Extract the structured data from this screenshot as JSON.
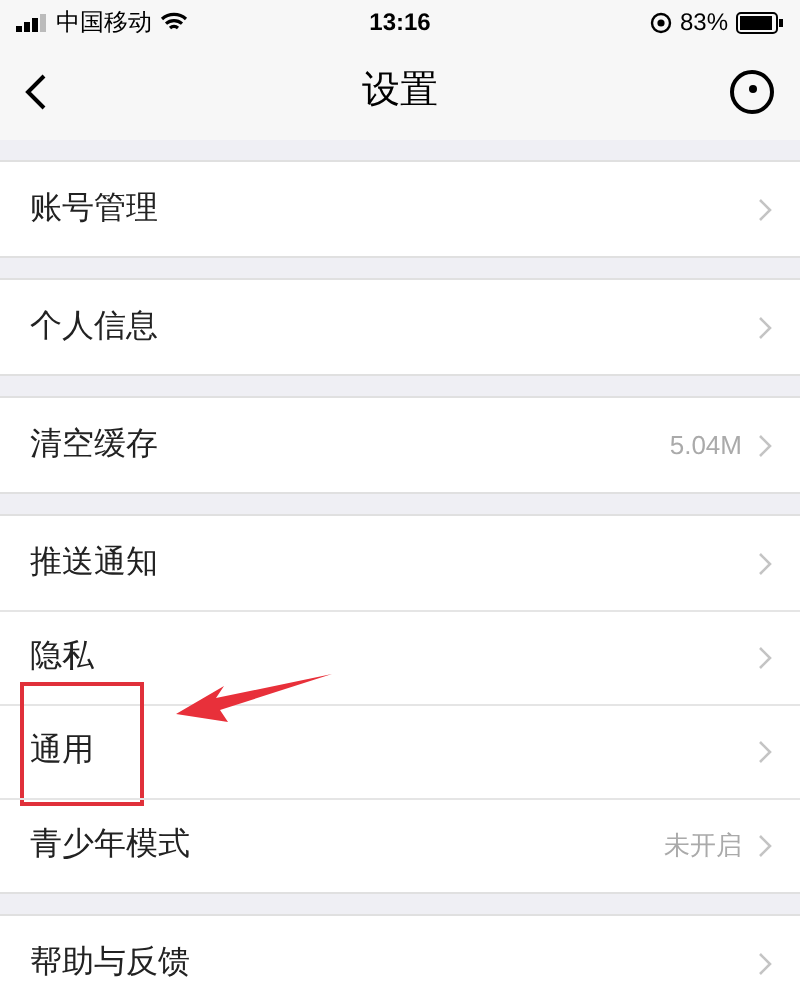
{
  "status_bar": {
    "carrier": "中国移动",
    "time": "13:16",
    "battery": "83%"
  },
  "nav": {
    "title": "设置"
  },
  "groups": [
    {
      "items": [
        {
          "label": "账号管理",
          "highlighted": false
        }
      ]
    },
    {
      "items": [
        {
          "label": "个人信息",
          "highlighted": false
        }
      ]
    },
    {
      "items": [
        {
          "label": "清空缓存",
          "value": "5.04M",
          "highlighted": false
        }
      ]
    },
    {
      "items": [
        {
          "label": "推送通知",
          "highlighted": false
        },
        {
          "label": "隐私",
          "highlighted": false
        },
        {
          "label": "通用",
          "highlighted": true
        },
        {
          "label": "青少年模式",
          "value": "未开启",
          "highlighted": false
        }
      ]
    },
    {
      "items": [
        {
          "label": "帮助与反馈",
          "highlighted": false
        }
      ]
    }
  ]
}
